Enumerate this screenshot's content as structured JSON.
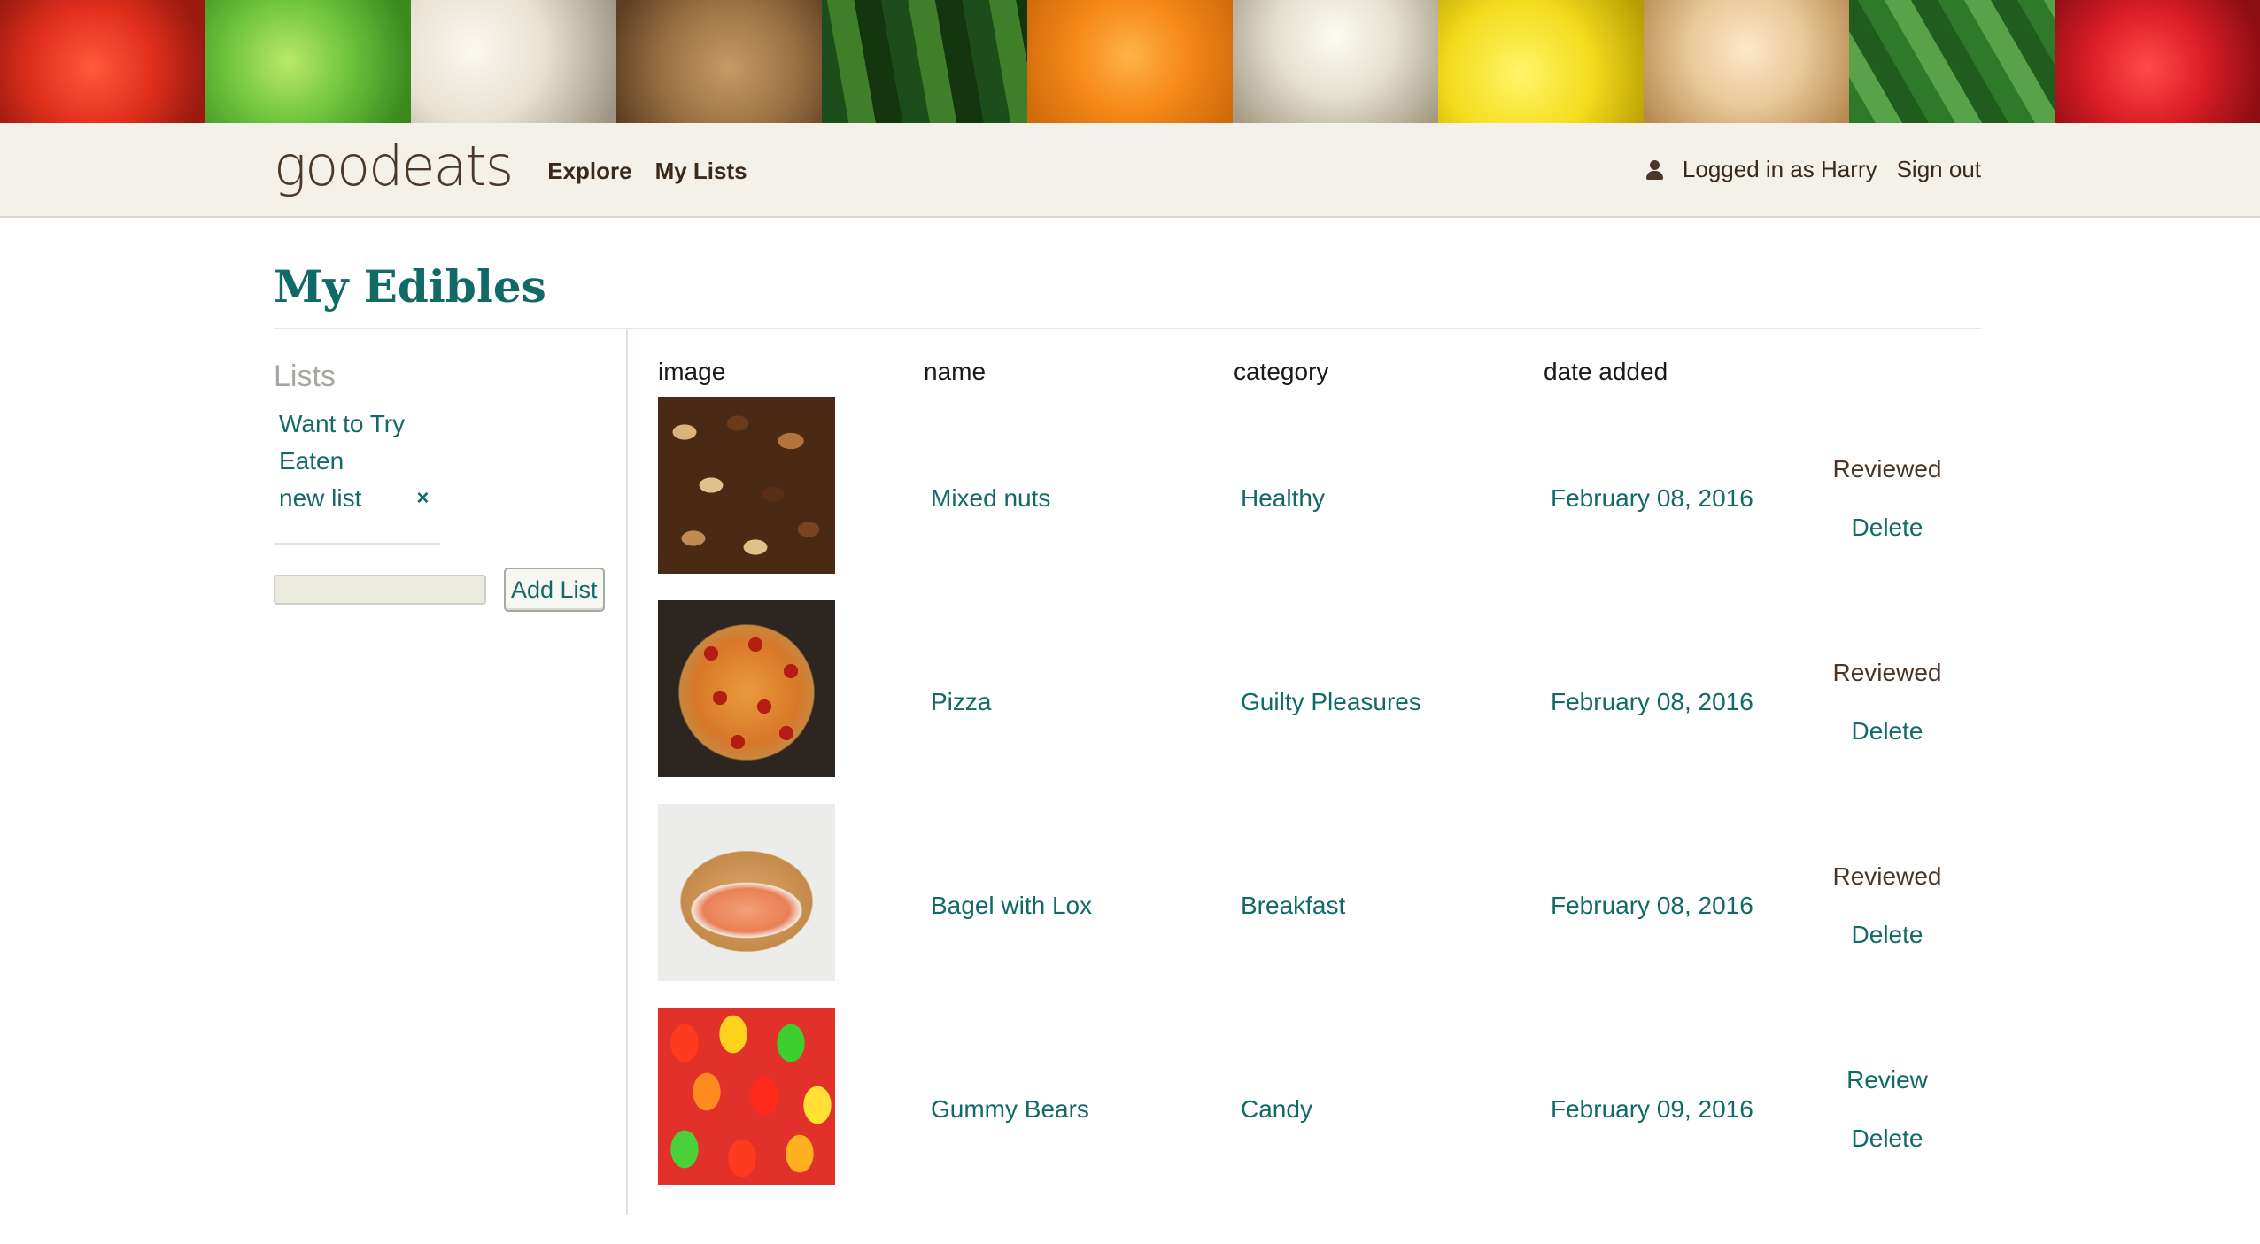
{
  "banner": {
    "tiles": [
      "tomato",
      "apple",
      "mushroom",
      "potato",
      "cucumber",
      "orange",
      "garlic",
      "lemon",
      "onion",
      "green-beans",
      "strawberry"
    ]
  },
  "header": {
    "logo": "goodeats",
    "nav": [
      {
        "label": "Explore"
      },
      {
        "label": "My Lists"
      }
    ],
    "user_icon": "user-icon",
    "logged_in_text": "Logged in as Harry",
    "sign_out": "Sign out"
  },
  "page": {
    "title": "My Edibles"
  },
  "sidebar": {
    "heading": "Lists",
    "lists": [
      {
        "label": "Want to Try"
      },
      {
        "label": "Eaten"
      },
      {
        "label": "new list",
        "remove": "×"
      }
    ],
    "new_list_input": {
      "value": "",
      "placeholder": ""
    },
    "add_button": "Add List"
  },
  "table": {
    "headers": {
      "image": "image",
      "name": "name",
      "category": "category",
      "date_added": "date added"
    },
    "rows": [
      {
        "image": "mixed-nuts",
        "name": "Mixed nuts",
        "category": "Healthy",
        "date": "February 08, 2016",
        "status": "Reviewed",
        "delete": "Delete"
      },
      {
        "image": "pizza",
        "name": "Pizza",
        "category": "Guilty Pleasures",
        "date": "February 08, 2016",
        "status": "Reviewed",
        "delete": "Delete"
      },
      {
        "image": "bagel-with-lox",
        "name": "Bagel with Lox",
        "category": "Breakfast",
        "date": "February 08, 2016",
        "status": "Reviewed",
        "delete": "Delete"
      },
      {
        "image": "gummy-bears",
        "name": "Gummy Bears",
        "category": "Candy",
        "date": "February 09, 2016",
        "review": "Review",
        "delete": "Delete"
      }
    ]
  },
  "colors": {
    "accent": "#126a66",
    "brown": "#3a2a1c",
    "topbar_bg": "#f4f1eb"
  }
}
